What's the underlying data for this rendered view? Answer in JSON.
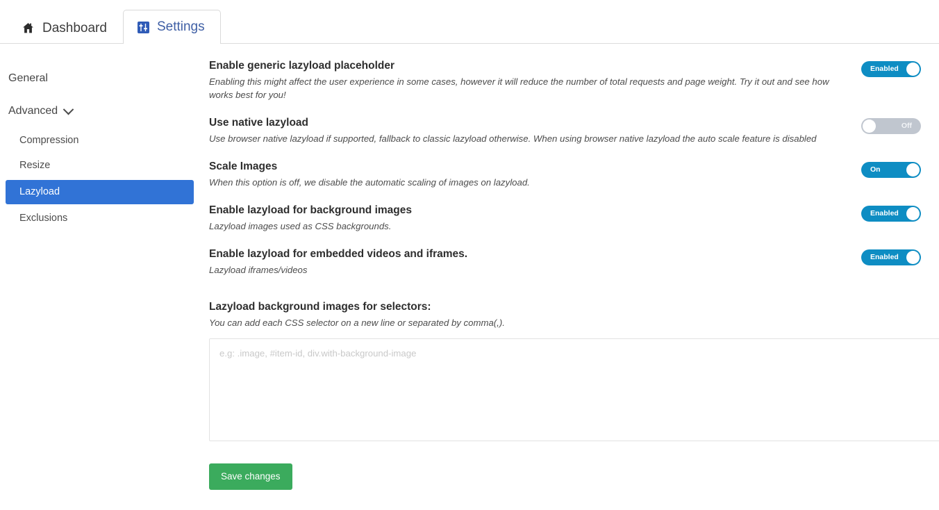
{
  "tabs": [
    {
      "id": "dashboard",
      "label": "Dashboard",
      "icon": "home-icon",
      "active": false
    },
    {
      "id": "settings",
      "label": "Settings",
      "icon": "settings-icon",
      "active": true
    }
  ],
  "sidebar": {
    "general_label": "General",
    "advanced_label": "Advanced",
    "items": [
      {
        "label": "Compression",
        "active": false
      },
      {
        "label": "Resize",
        "active": false
      },
      {
        "label": "Lazyload",
        "active": true
      },
      {
        "label": "Exclusions",
        "active": false
      }
    ]
  },
  "settings_rows": [
    {
      "title": "Enable generic lazyload placeholder",
      "description": "Enabling this might affect the user experience in some cases, however it will reduce the number of total requests and page weight. Try it out and see how works best for you!",
      "toggle_state": "on",
      "toggle_label": "Enabled"
    },
    {
      "title": "Use native lazyload",
      "description": "Use browser native lazyload if supported, fallback to classic lazyload otherwise. When using browser native lazyload the auto scale feature is disabled",
      "toggle_state": "off",
      "toggle_label": "Off"
    },
    {
      "title": "Scale Images",
      "description": "When this option is off, we disable the automatic scaling of images on lazyload.",
      "toggle_state": "on",
      "toggle_label": "On"
    },
    {
      "title": "Enable lazyload for background images",
      "description": "Lazyload images used as CSS backgrounds.",
      "toggle_state": "on",
      "toggle_label": "Enabled"
    },
    {
      "title": "Enable lazyload for embedded videos and iframes.",
      "description": "Lazyload iframes/videos",
      "toggle_state": "on",
      "toggle_label": "Enabled"
    }
  ],
  "selectors_field": {
    "title": "Lazyload background images for selectors:",
    "description": "You can add each CSS selector on a new line or separated by comma(,).",
    "placeholder": "e.g: .image, #item-id, div.with-background-image",
    "value": ""
  },
  "save_button": {
    "label": "Save changes"
  },
  "colors": {
    "toggle_on": "#0e8dc3",
    "toggle_off": "#c0c6cf",
    "sidebar_active": "#3173d6",
    "save_button": "#3bab5d",
    "active_tab_text": "#3f5fa5",
    "settings_icon": "#2f5bb7"
  }
}
